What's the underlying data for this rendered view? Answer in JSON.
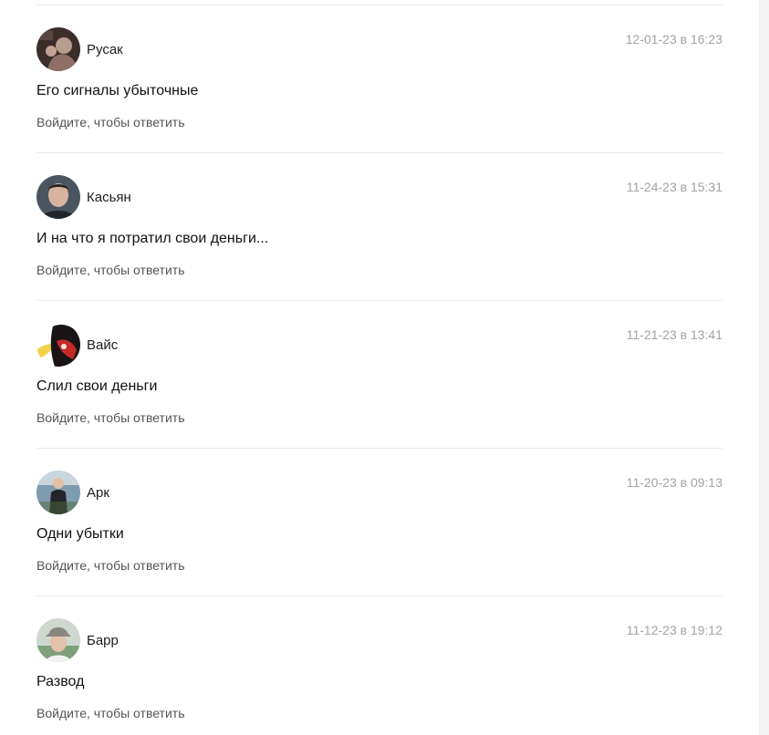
{
  "comments": [
    {
      "author": "Русак",
      "date": "12-01-23 в 16:23",
      "text": "Его сигналы убыточные",
      "reply_label": "Войдите, чтобы ответить"
    },
    {
      "author": "Касьян",
      "date": "11-24-23 в 15:31",
      "text": "И на что я потратил свои деньги...",
      "reply_label": "Войдите, чтобы ответить"
    },
    {
      "author": "Вайс",
      "date": "11-21-23 в 13:41",
      "text": "Слил свои деньги",
      "reply_label": "Войдите, чтобы ответить"
    },
    {
      "author": "Арк",
      "date": "11-20-23 в 09:13",
      "text": "Одни убытки",
      "reply_label": "Войдите, чтобы ответить"
    },
    {
      "author": "Барр",
      "date": "11-12-23 в 19:12",
      "text": "Развод",
      "reply_label": "Войдите, чтобы ответить"
    }
  ]
}
